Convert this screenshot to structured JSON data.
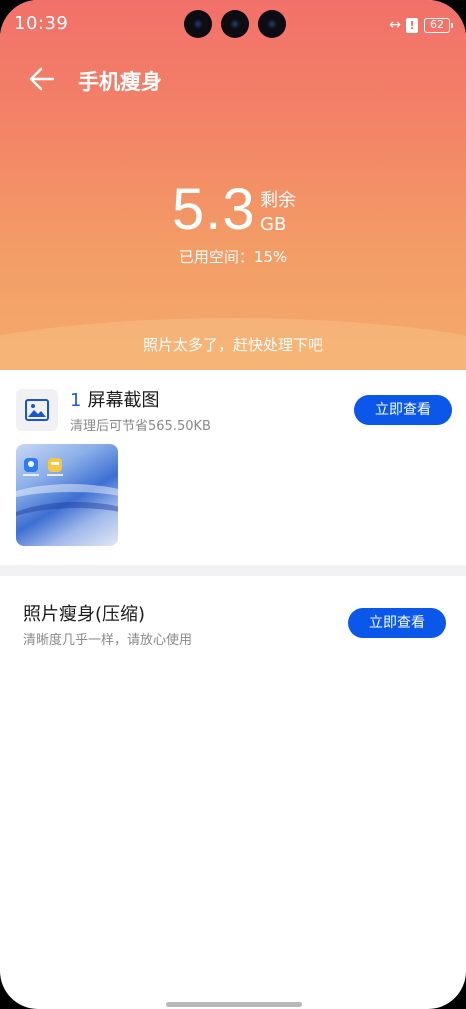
{
  "status_bar": {
    "time": "10:39",
    "link_icon": "↔",
    "alert_icon": "!",
    "battery": "62"
  },
  "header": {
    "title": "手机瘦身",
    "back_icon": "arrow-left-icon"
  },
  "storage": {
    "remaining_value": "5.3",
    "remaining_label": "剩余",
    "unit": "GB",
    "used_text": "已用空间：15%"
  },
  "hero_tip": "照片太多了，赶快处理下吧",
  "screenshots_card": {
    "count": "1",
    "title": "屏幕截图",
    "subtitle": "清理后可节省565.50KB",
    "button_label": "立即查看",
    "icon": "gallery-icon"
  },
  "compress_card": {
    "title": "照片瘦身(压缩)",
    "subtitle": "清晰度几乎一样，请放心使用",
    "button_label": "立即查看"
  },
  "colors": {
    "accent_blue": "#0b57e9",
    "hero_top": "#f2706a",
    "hero_bottom": "#f4ab6c"
  }
}
